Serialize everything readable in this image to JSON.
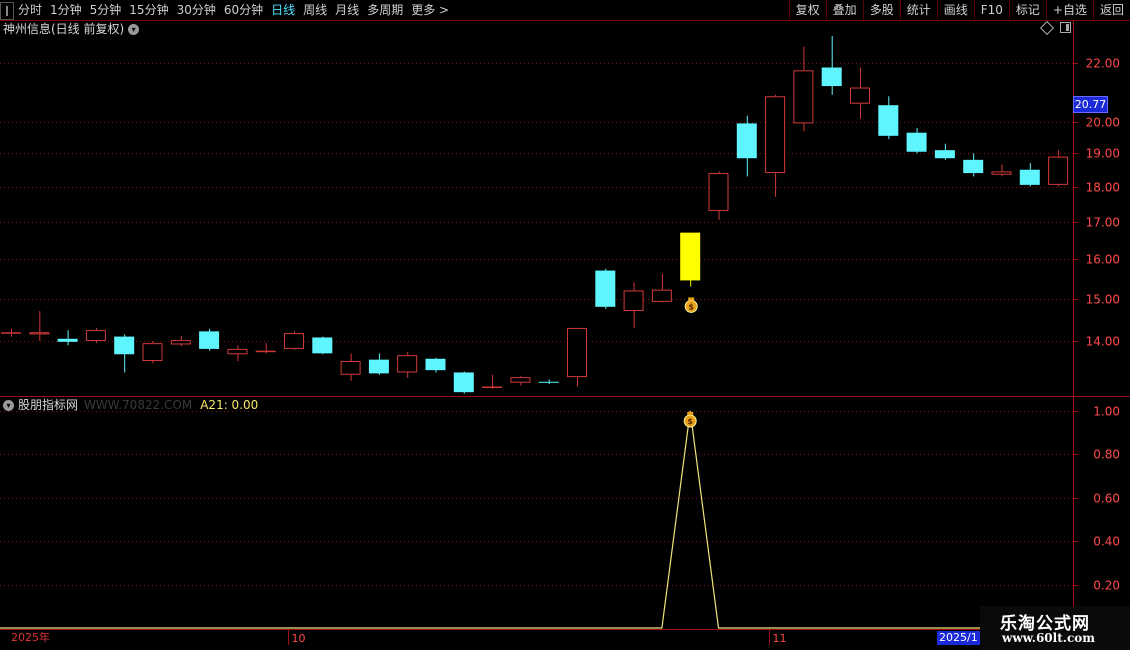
{
  "toolbar": {
    "periods": [
      "分时",
      "1分钟",
      "5分钟",
      "15分钟",
      "30分钟",
      "60分钟",
      "日线",
      "周线",
      "月线",
      "多周期",
      "更多 >"
    ],
    "active_period": "日线",
    "buttons": [
      "复权",
      "叠加",
      "多股",
      "统计",
      "画线",
      "F10",
      "标记",
      "+自选",
      "返回"
    ]
  },
  "chart": {
    "title": "神州信息(日线 前复权)",
    "last_price_tag": "20.77"
  },
  "indicator": {
    "name": "股朋指标网",
    "watermark": "WWW.70822.COM",
    "value_label": "A21: 0.00"
  },
  "date_axis": {
    "start_label": "2025年",
    "month_labels": [
      {
        "label": "10",
        "index": 10
      },
      {
        "label": "11",
        "index": 27
      }
    ],
    "end_label": "2025/1"
  },
  "brand": {
    "name": "乐淘公式网",
    "url": "www.60lt.com"
  },
  "colors": {
    "up": "#d23a3a",
    "down": "#5ef5ff",
    "signal": "#ffff00",
    "indicator_line": "#f0e37a",
    "grid": "#7a1010",
    "axis_text": "#ff4a4a"
  },
  "chart_data": [
    {
      "type": "candlestick",
      "y_ticks": [
        14.0,
        15.0,
        16.0,
        17.0,
        18.0,
        19.0,
        20.0,
        22.0
      ],
      "ylim": [
        12.8,
        23.0
      ],
      "log_scale": true,
      "candles": [
        {
          "o": 14.2,
          "c": 14.2,
          "h": 14.28,
          "l": 14.1
        },
        {
          "o": 14.15,
          "c": 14.2,
          "h": 14.7,
          "l": 14.0
        },
        {
          "o": 14.05,
          "c": 13.98,
          "h": 14.25,
          "l": 13.9
        },
        {
          "o": 14.0,
          "c": 14.25,
          "h": 14.3,
          "l": 13.95
        },
        {
          "o": 14.1,
          "c": 13.7,
          "h": 14.15,
          "l": 13.3
        },
        {
          "o": 13.55,
          "c": 13.95,
          "h": 14.0,
          "l": 13.5
        },
        {
          "o": 13.92,
          "c": 14.02,
          "h": 14.12,
          "l": 13.88
        },
        {
          "o": 14.22,
          "c": 13.82,
          "h": 14.28,
          "l": 13.78
        },
        {
          "o": 13.7,
          "c": 13.82,
          "h": 13.9,
          "l": 13.55
        },
        {
          "o": 13.75,
          "c": 13.78,
          "h": 13.95,
          "l": 13.72
        },
        {
          "o": 13.82,
          "c": 14.18,
          "h": 14.22,
          "l": 13.8
        },
        {
          "o": 14.08,
          "c": 13.72,
          "h": 14.1,
          "l": 13.7
        },
        {
          "o": 13.25,
          "c": 13.55,
          "h": 13.72,
          "l": 13.12
        },
        {
          "o": 13.58,
          "c": 13.28,
          "h": 13.72,
          "l": 13.25
        },
        {
          "o": 13.3,
          "c": 13.68,
          "h": 13.75,
          "l": 13.18
        },
        {
          "o": 13.6,
          "c": 13.35,
          "h": 13.62,
          "l": 13.3
        },
        {
          "o": 13.3,
          "c": 12.88,
          "h": 13.32,
          "l": 12.85
        },
        {
          "o": 12.98,
          "c": 13.0,
          "h": 13.25,
          "l": 12.95
        },
        {
          "o": 13.08,
          "c": 13.2,
          "h": 13.22,
          "l": 13.02
        },
        {
          "o": 13.1,
          "c": 13.08,
          "h": 13.15,
          "l": 13.05
        },
        {
          "o": 13.2,
          "c": 14.3,
          "h": 14.3,
          "l": 13.0
        },
        {
          "o": 15.7,
          "c": 14.8,
          "h": 15.75,
          "l": 14.75
        },
        {
          "o": 14.7,
          "c": 15.2,
          "h": 15.4,
          "l": 14.3
        },
        {
          "o": 14.92,
          "c": 15.22,
          "h": 15.62,
          "l": 14.9
        },
        {
          "o": 15.45,
          "c": 16.7,
          "h": 16.7,
          "l": 15.3,
          "signal": true
        },
        {
          "o": 17.3,
          "c": 18.4,
          "h": 18.45,
          "l": 17.05
        },
        {
          "o": 19.95,
          "c": 18.85,
          "h": 20.2,
          "l": 18.3
        },
        {
          "o": 18.4,
          "c": 20.85,
          "h": 20.9,
          "l": 17.7
        },
        {
          "o": 19.95,
          "c": 21.75,
          "h": 22.6,
          "l": 19.7
        },
        {
          "o": 21.85,
          "c": 21.2,
          "h": 23.0,
          "l": 20.9
        },
        {
          "o": 20.6,
          "c": 21.15,
          "h": 21.85,
          "l": 20.1
        },
        {
          "o": 20.55,
          "c": 19.55,
          "h": 20.85,
          "l": 19.45
        },
        {
          "o": 19.65,
          "c": 19.05,
          "h": 19.8,
          "l": 19.0
        },
        {
          "o": 19.1,
          "c": 18.85,
          "h": 19.3,
          "l": 18.8
        },
        {
          "o": 18.8,
          "c": 18.4,
          "h": 19.0,
          "l": 18.3
        },
        {
          "o": 18.35,
          "c": 18.45,
          "h": 18.65,
          "l": 18.3
        },
        {
          "o": 18.5,
          "c": 18.05,
          "h": 18.7,
          "l": 18.0
        },
        {
          "o": 18.05,
          "c": 18.9,
          "h": 19.1,
          "l": 18.0
        }
      ]
    },
    {
      "type": "line",
      "name": "A21",
      "y_ticks": [
        0.2,
        0.4,
        0.6,
        0.8,
        1.0
      ],
      "ylim": [
        0.0,
        1.06
      ],
      "values": [
        0,
        0,
        0,
        0,
        0,
        0,
        0,
        0,
        0,
        0,
        0,
        0,
        0,
        0,
        0,
        0,
        0,
        0,
        0,
        0,
        0,
        0,
        0,
        0,
        1,
        0,
        0,
        0,
        0,
        0,
        0,
        0,
        0,
        0,
        0,
        0,
        0,
        0
      ]
    }
  ]
}
